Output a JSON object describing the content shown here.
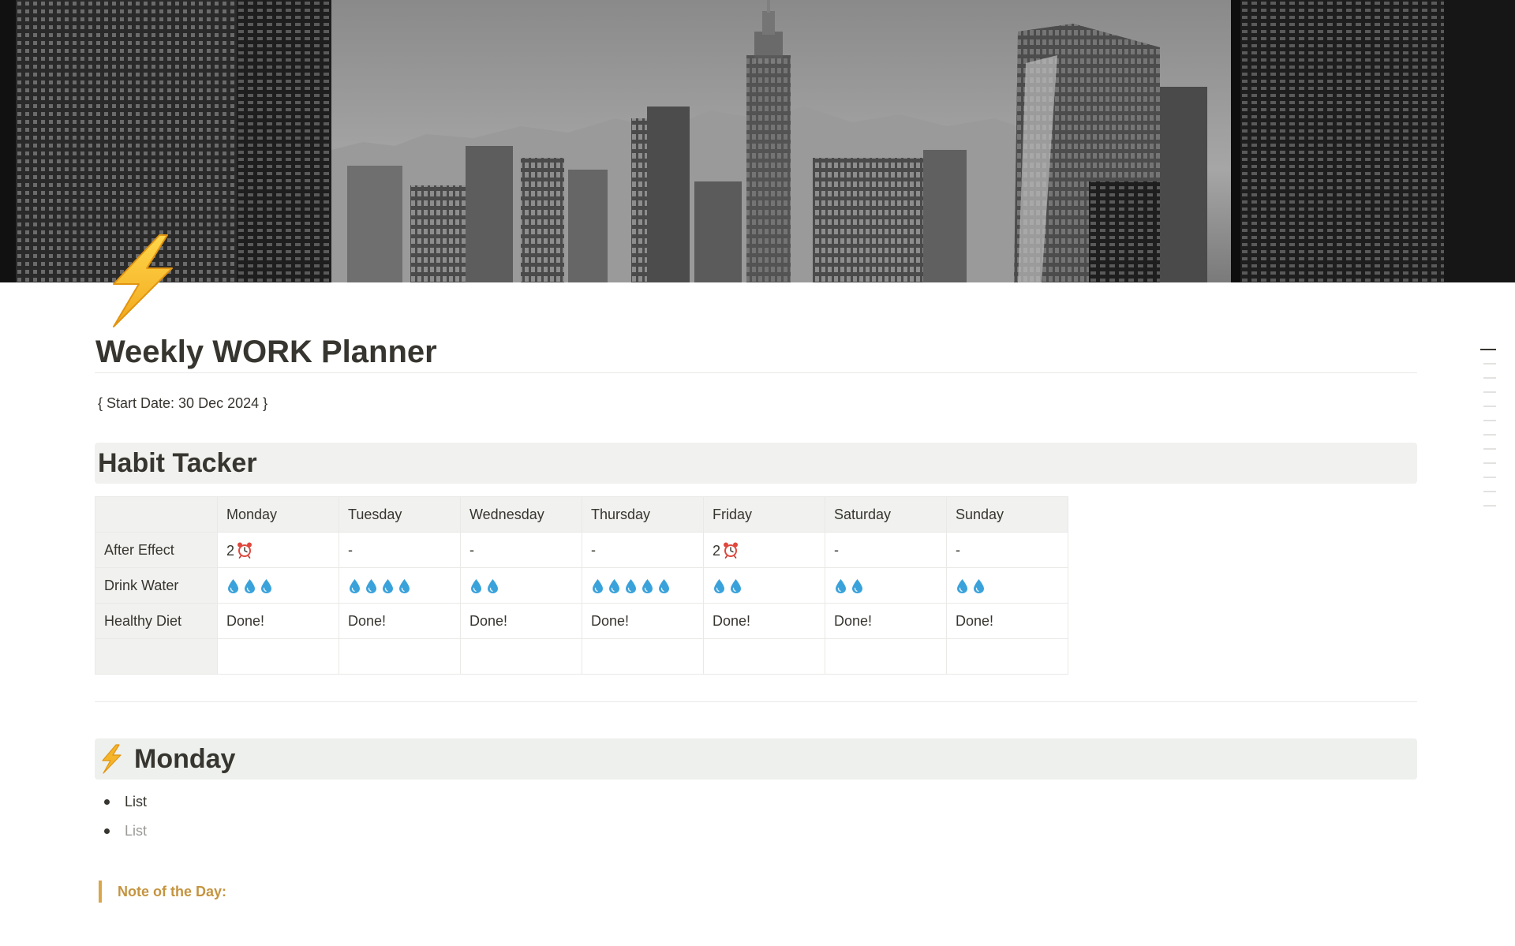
{
  "page": {
    "title": "Weekly WORK Planner",
    "start_date": "{ Start Date: 30 Dec 2024 }"
  },
  "cover": {
    "icon": "city-skyline-cover"
  },
  "page_icon": "lightning-bolt-icon",
  "habit_tracker": {
    "heading": "Habit Tacker",
    "columns": [
      "",
      "Monday",
      "Tuesday",
      "Wednesday",
      "Thursday",
      "Friday",
      "Saturday",
      "Sunday"
    ],
    "rows": [
      {
        "label": "After Effect",
        "cells": [
          {
            "text": "2",
            "clock": true
          },
          {
            "text": "-",
            "clock": false
          },
          {
            "text": "-",
            "clock": false
          },
          {
            "text": "-",
            "clock": false
          },
          {
            "text": "2",
            "clock": true
          },
          {
            "text": "-",
            "clock": false
          },
          {
            "text": "-",
            "clock": false
          }
        ]
      },
      {
        "label": "Drink Water",
        "drops": [
          3,
          4,
          2,
          5,
          2,
          2,
          2
        ]
      },
      {
        "label": "Healthy Diet",
        "cells": [
          "Done!",
          "Done!",
          "Done!",
          "Done!",
          "Done!",
          "Done!",
          "Done!"
        ]
      }
    ]
  },
  "monday": {
    "heading": "Monday",
    "icon": "lightning-bolt-icon",
    "list": [
      {
        "text": "List",
        "placeholder": false
      },
      {
        "text": "List",
        "placeholder": true
      }
    ]
  },
  "note": {
    "label": "Note of the Day:"
  },
  "colors": {
    "text": "#37352f",
    "heading_gray_bg": "#f1f1ef",
    "heading_green_bg": "#edf0ec",
    "callout_accent": "#c59440",
    "divider": "#e9e9e7"
  }
}
